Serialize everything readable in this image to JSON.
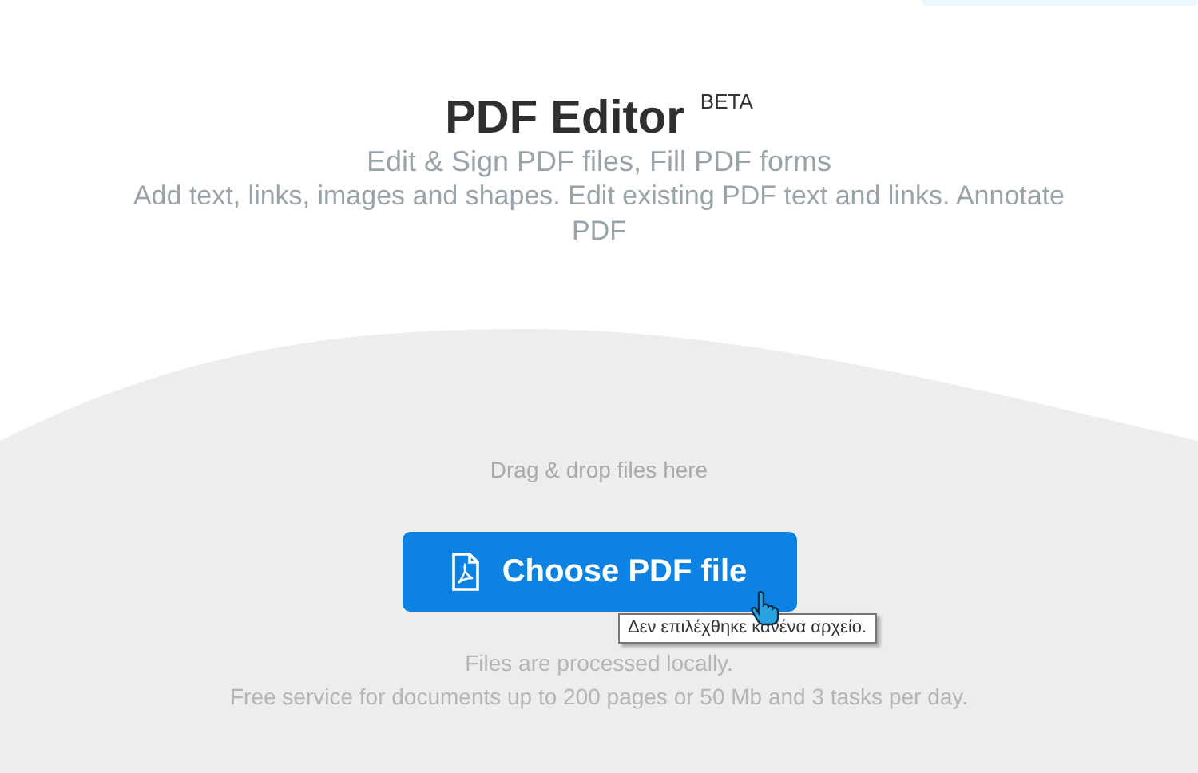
{
  "title": "PDF Editor",
  "badge": "BETA",
  "subtitle": "Edit & Sign PDF files, Fill PDF forms",
  "description_lines": [
    "Add text, links, images and shapes. Edit existing PDF text and links. Annotate",
    "PDF"
  ],
  "drop_hint": "Drag & drop files here",
  "button": {
    "label": "Choose PDF file"
  },
  "tooltip": "Δεν επιλέχθηκε κανένα αρχείο.",
  "notes": [
    "Files are processed locally.",
    "Free service for documents up to 200 pages or 50 Mb and 3 tasks per day."
  ]
}
